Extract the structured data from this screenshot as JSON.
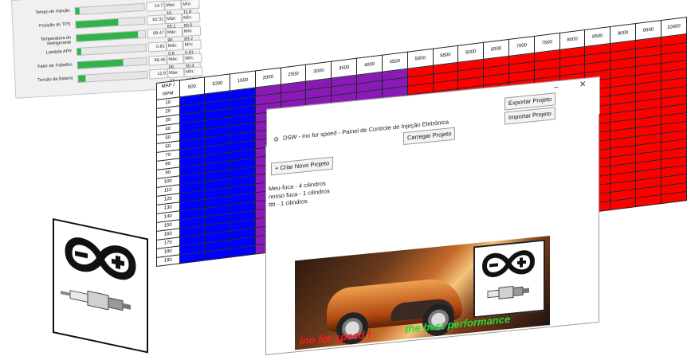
{
  "sensors": [
    {
      "label": "Tempo de Injeção",
      "value": "14.7",
      "max": "Máx: 16.",
      "min": "Mín: 11.8",
      "level": 0.05
    },
    {
      "label": "Posição do TPS",
      "value": "62.31",
      "max": "Máx: 65.1",
      "min": "Mín: 60.0",
      "level": 0.62
    },
    {
      "label": "Temperatura do Refrigerante",
      "value": "89.47",
      "max": "Máx: 90.",
      "min": "Mín: 83.2",
      "level": 0.89
    },
    {
      "label": "Lambda AFR",
      "value": "0.81",
      "max": "Máx: 0.8",
      "min": "Mín: 0.81",
      "level": 0.0
    },
    {
      "label": "Fator de Trabalho",
      "value": "66.46",
      "max": "Máx: 66.",
      "min": "Mín: 50.3",
      "level": 0.66
    },
    {
      "label": "Tensão da Bateria",
      "value": "12.8",
      "max": "Máx: 12.",
      "min": "Mín: 12.3",
      "level": 0.1
    }
  ],
  "ve_table": {
    "corner": "MAP / RPM",
    "rpm": [
      "500",
      "1000",
      "1500",
      "2000",
      "2500",
      "3000",
      "3500",
      "4000",
      "4500",
      "5000",
      "5500",
      "6000",
      "6500",
      "7000",
      "7500",
      "8000",
      "8500",
      "9000",
      "9500",
      "10000"
    ],
    "map": [
      "10",
      "20",
      "30",
      "40",
      "50",
      "60",
      "70",
      "80",
      "90",
      "100",
      "110",
      "120",
      "130",
      "140",
      "150",
      "160",
      "170",
      "180",
      "190"
    ],
    "colors": {
      "blue": "#0000ff",
      "purple": "#8a1ab8",
      "red": "#ff0000"
    }
  },
  "dialog": {
    "title": "DSW - ino for speed - Painel de Controle de Injeção Eletrônica",
    "buttons": {
      "export": "Exportar Projeto",
      "import": "Importar Projeto",
      "load": "Carregar Projeto",
      "new": "+ Criar Novo Projeto"
    },
    "projects": [
      "Meu-fuca - 4 cilindros",
      "nosso fuca - 1 cilindros",
      "tttt - 1 cilindros"
    ],
    "banner": {
      "text_red": "ino for speed !",
      "text_green": "the best performance"
    }
  },
  "icons": {
    "app": "app-icon",
    "minimize": "minimize-icon",
    "close": "close-icon",
    "infinity_logo": "infinity-plus-minus-icon",
    "spark_plug": "spark-plug-icon"
  }
}
